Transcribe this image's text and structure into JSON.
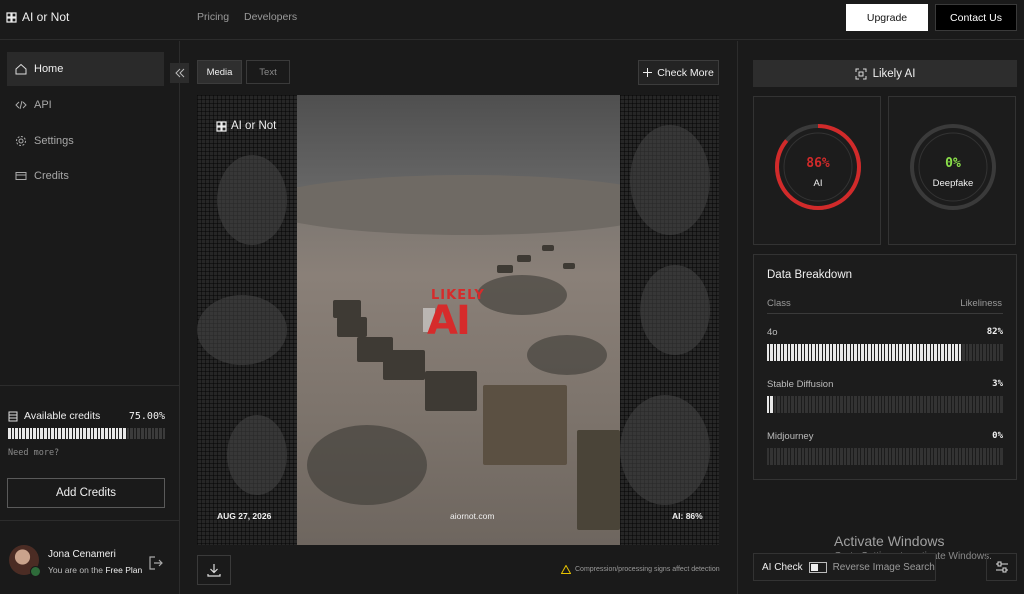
{
  "brand": {
    "name": "AI or Not"
  },
  "nav": {
    "pricing": "Pricing",
    "developers": "Developers"
  },
  "header": {
    "upgrade": "Upgrade",
    "contact": "Contact Us"
  },
  "sidebar": {
    "items": [
      {
        "label": "Home",
        "icon": "home-icon",
        "active": true
      },
      {
        "label": "API",
        "icon": "code-icon"
      },
      {
        "label": "Settings",
        "icon": "gear-icon"
      },
      {
        "label": "Credits",
        "icon": "card-icon"
      }
    ],
    "credits": {
      "label": "Available credits",
      "value": "75.00%",
      "fraction": 0.75,
      "need_more": "Need more?",
      "add_button": "Add Credits"
    },
    "user": {
      "name": "Jona Cenameri",
      "plan_prefix": "You are on the ",
      "plan": "Free Plan"
    }
  },
  "tabs": {
    "media": "Media",
    "text": "Text"
  },
  "check_more": "Check More",
  "media": {
    "watermark": "AI or Not",
    "stamp_top": "LIKELY",
    "stamp_main": "AI",
    "date": "AUG 27, 2026",
    "site": "aiornot.com",
    "ai_score": "AI: 86%"
  },
  "compression_note": "Compression/processing signs affect detection",
  "result": {
    "verdict": "Likely AI",
    "ai": {
      "value": "86%",
      "label": "AI",
      "fraction": 0.86,
      "color": "#d12a2a"
    },
    "deepfake": {
      "value": "0%",
      "label": "Deepfake",
      "fraction": 0,
      "color": "#8be04a"
    }
  },
  "breakdown": {
    "title": "Data Breakdown",
    "col_class": "Class",
    "col_likeliness": "Likeliness",
    "rows": [
      {
        "name": "4o",
        "pct": "82%",
        "fraction": 0.82
      },
      {
        "name": "Stable Diffusion",
        "pct": "3%",
        "fraction": 0.03
      },
      {
        "name": "Midjourney",
        "pct": "0%",
        "fraction": 0
      }
    ]
  },
  "bottom": {
    "ai_check": "AI Check",
    "reverse_search": "Reverse Image Search"
  },
  "activate": {
    "title": "Activate Windows",
    "subtitle": "Go to Settings to activate Windows."
  }
}
